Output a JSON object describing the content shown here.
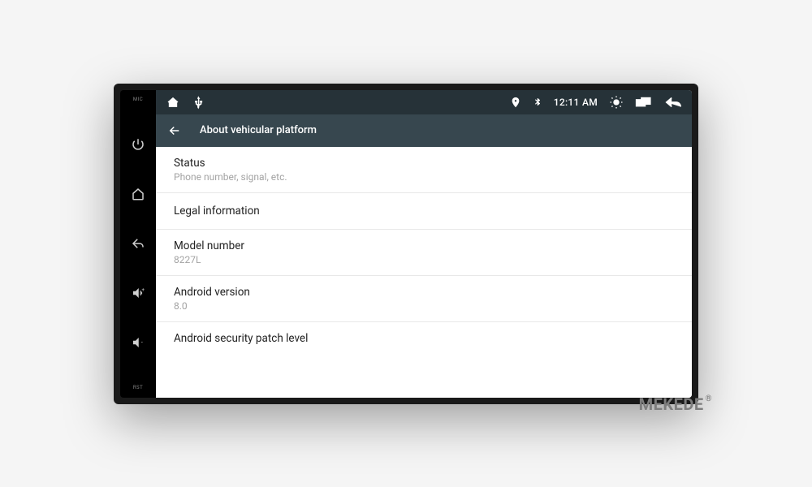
{
  "hardware": {
    "mic_label": "MIC",
    "rst_label": "RST"
  },
  "status_bar": {
    "time": "12:11 AM"
  },
  "app_bar": {
    "title": "About vehicular platform"
  },
  "settings": [
    {
      "title": "Status",
      "subtitle": "Phone number, signal, etc."
    },
    {
      "title": "Legal information",
      "subtitle": null
    },
    {
      "title": "Model number",
      "subtitle": "8227L"
    },
    {
      "title": "Android version",
      "subtitle": "8.0"
    },
    {
      "title": "Android security patch level",
      "subtitle": null
    }
  ],
  "brand": {
    "name": "MEKEDE",
    "mark": "®"
  }
}
